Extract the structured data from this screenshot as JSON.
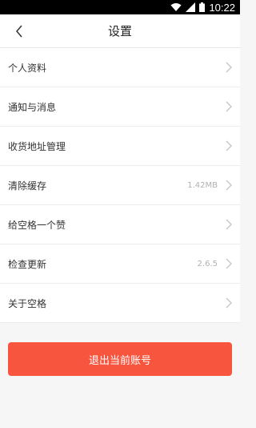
{
  "status_bar": {
    "time": "10:22"
  },
  "header": {
    "title": "设置"
  },
  "items": [
    {
      "label": "个人资料",
      "value": ""
    },
    {
      "label": "通知与消息",
      "value": ""
    },
    {
      "label": "收货地址管理",
      "value": ""
    },
    {
      "label": "清除缓存",
      "value": "1.42MB"
    },
    {
      "label": "给空格一个赞",
      "value": ""
    },
    {
      "label": "检查更新",
      "value": "2.6.5"
    },
    {
      "label": "关于空格",
      "value": ""
    }
  ],
  "logout_label": "退出当前账号",
  "colors": {
    "accent": "#f8553f",
    "header_bg": "#ffffff",
    "page_bg": "#f6f6f6"
  }
}
